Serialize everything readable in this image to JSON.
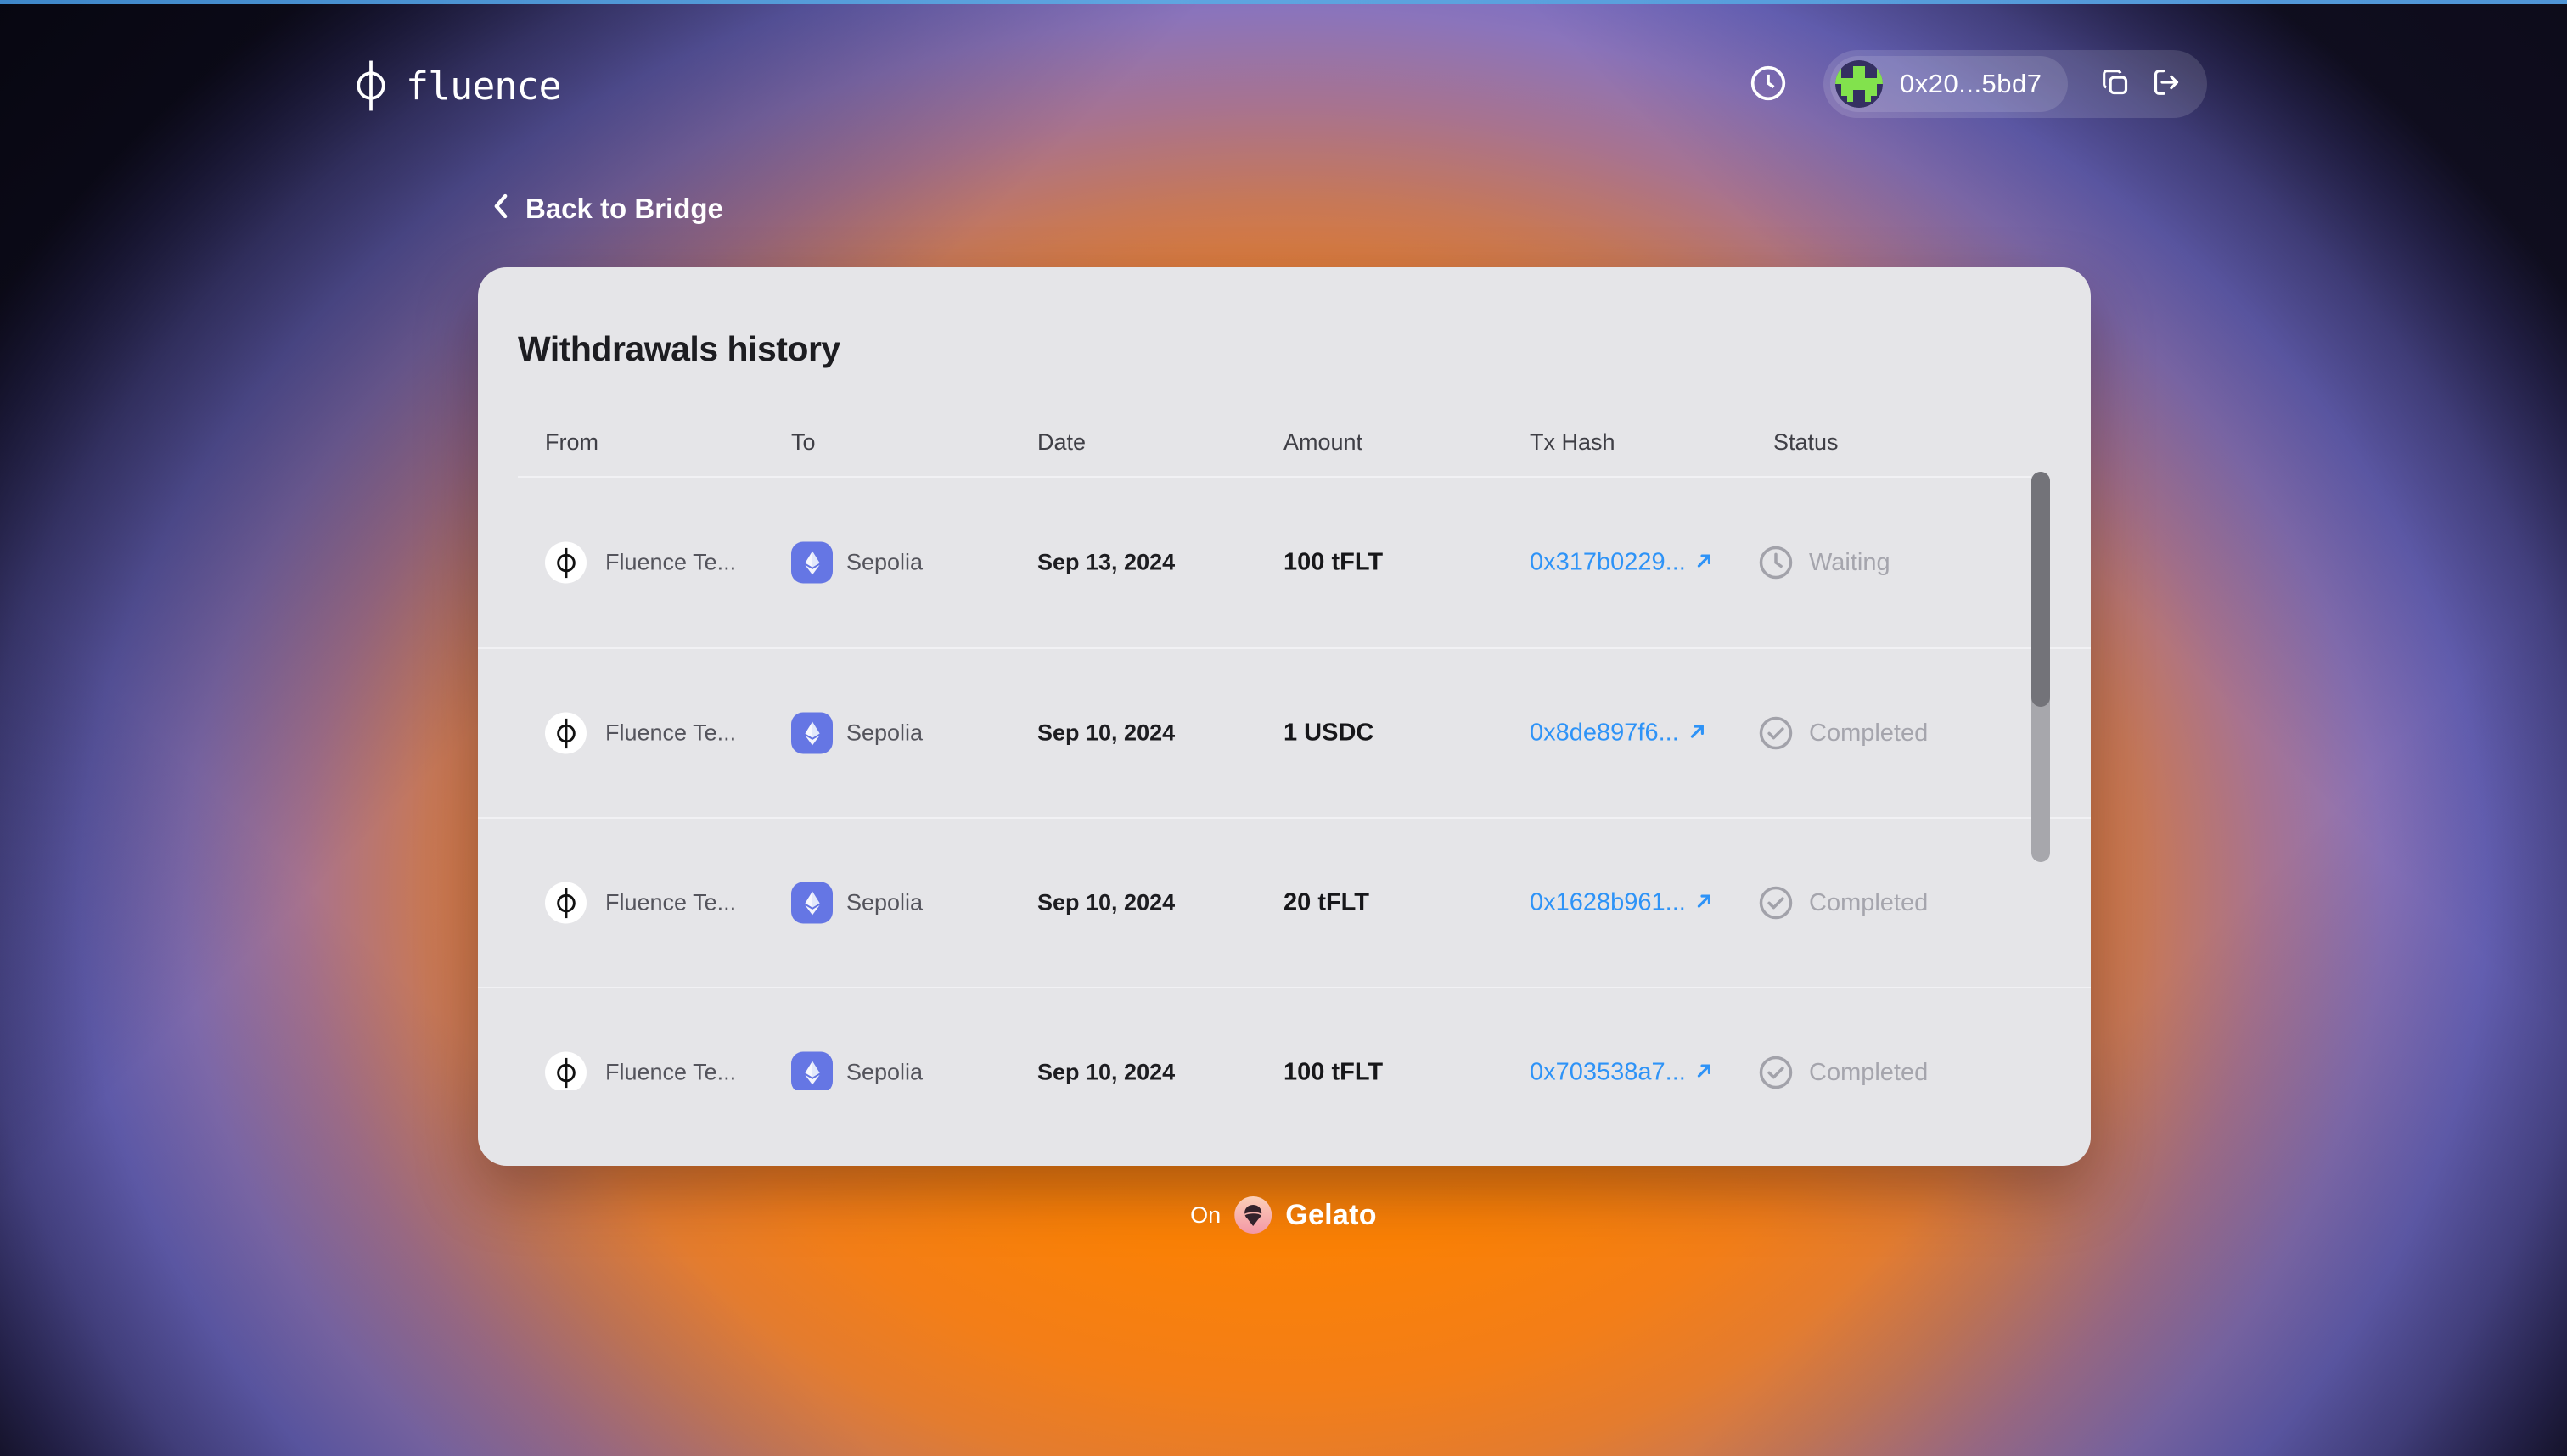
{
  "topbar": {
    "brand": "fluence",
    "wallet": {
      "address": "0x20...5bd7"
    }
  },
  "nav": {
    "back": "Back to Bridge"
  },
  "panel": {
    "title": "Withdrawals history",
    "columns": {
      "from": "From",
      "to": "To",
      "date": "Date",
      "amount": "Amount",
      "tx": "Tx Hash",
      "status": "Status"
    },
    "rows": [
      {
        "from": "Fluence Te...",
        "to": "Sepolia",
        "date": "Sep 13, 2024",
        "amount": "100 tFLT",
        "tx": "0x317b0229...",
        "status": "Waiting"
      },
      {
        "from": "Fluence Te...",
        "to": "Sepolia",
        "date": "Sep 10, 2024",
        "amount": "1 USDC",
        "tx": "0x8de897f6...",
        "status": "Completed"
      },
      {
        "from": "Fluence Te...",
        "to": "Sepolia",
        "date": "Sep 10, 2024",
        "amount": "20 tFLT",
        "tx": "0x1628b961...",
        "status": "Completed"
      },
      {
        "from": "Fluence Te...",
        "to": "Sepolia",
        "date": "Sep 10, 2024",
        "amount": "100 tFLT",
        "tx": "0x703538a7...",
        "status": "Completed"
      }
    ]
  },
  "footer": {
    "on": "On",
    "brand": "Gelato"
  },
  "colors": {
    "accent_orange": "#ff8500",
    "link_blue": "#2e93f7",
    "chain_blue": "#6576e4",
    "status_gray": "#a5a5ad",
    "card_bg": "#e5e5e8",
    "top_line_blue": "#4f95d6"
  }
}
